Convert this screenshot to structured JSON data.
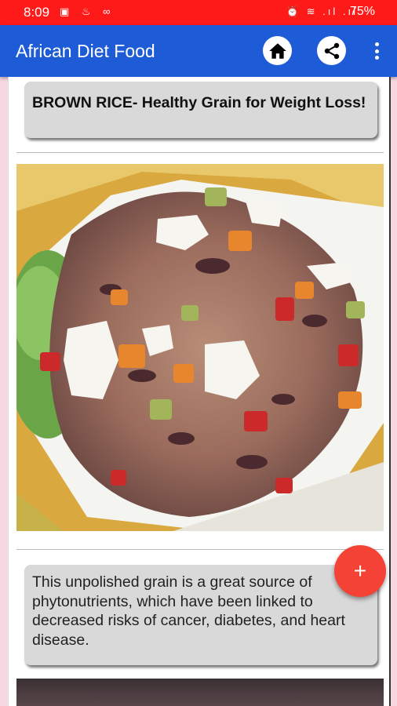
{
  "status_bar": {
    "time": "8:09",
    "left_icons": "▣ ♨ ∞",
    "right_icons": "⏰ ≋ .ıl .ıl",
    "battery": "75%"
  },
  "app_bar": {
    "title": "African Diet Food",
    "icons": [
      "home-icon",
      "share-icon",
      "more-vert-icon"
    ]
  },
  "article": {
    "title": "BROWN RICE- Healthy Grain for Weight Loss!",
    "description": "This unpolished grain is a great source of phytonutrients, which have been linked to decreased risks of cancer, diabetes, and heart disease."
  },
  "fab": {
    "label": "+"
  },
  "colors": {
    "status_bar": "#ff1a1a",
    "app_bar": "#1e5bd6",
    "fab": "#f44336",
    "card": "#d9d9d9",
    "side_bg": "#f7d7e0"
  }
}
